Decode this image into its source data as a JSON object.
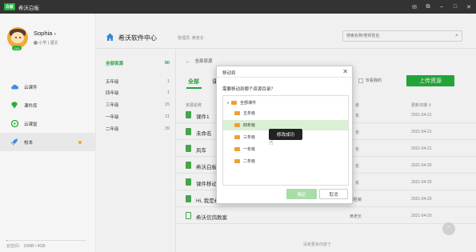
{
  "app": {
    "logo_text": "白板",
    "title": "希沃白板",
    "window_controls": [
      "mail-icon",
      "share-icon",
      "minimize-icon",
      "maximize-icon",
      "close-icon"
    ]
  },
  "user": {
    "name": "Sophia",
    "name_arrow": "▾",
    "meta": "小学 | 语文",
    "level": "LV1"
  },
  "sidebar": {
    "items": [
      {
        "label": "云课件",
        "icon": "cloud-icon"
      },
      {
        "label": "课件库",
        "icon": "diamond-icon"
      },
      {
        "label": "云课堂",
        "icon": "play-circle-icon"
      },
      {
        "label": "校本",
        "icon": "rocket-icon"
      }
    ],
    "storage": "云空间：  16MB / 4GB",
    "storage_fraction": 0.004
  },
  "header": {
    "org_name": "希沃软件中心",
    "admin": "管理员: 黄老长",
    "search_placeholder": "搜索名称/老师姓名",
    "search_icon": "search-icon"
  },
  "categories": {
    "head": {
      "label": "全部资源",
      "count": "90"
    },
    "items": [
      {
        "label": "五年级",
        "count": "1"
      },
      {
        "label": "四年级",
        "count": "1"
      },
      {
        "label": "三年级",
        "count": "15"
      },
      {
        "label": "一年级",
        "count": "11"
      },
      {
        "label": "二年级",
        "count": "39"
      }
    ]
  },
  "main": {
    "back_arrow": "←",
    "crumb": "全部资源",
    "tab_all": "全部",
    "tab_2": "课",
    "mine_only": "仅看我的",
    "upload": "上传资源",
    "col_name": "资源名称",
    "col_owner": "者",
    "col_date": "更新日期 ⇕",
    "rows": [
      {
        "name": "课件1",
        "owner": "长",
        "date": "2021-04-21"
      },
      {
        "name": "未命名",
        "owner": "长",
        "date": "2021-04-21"
      },
      {
        "name": "风车",
        "owner": "长",
        "date": "2021-04-21"
      },
      {
        "name": "希沃白板",
        "owner": "长",
        "date": "2021-04-20"
      },
      {
        "name": "课件移动",
        "owner": "长",
        "date": "2021-04-20"
      },
      {
        "name": "Hi, 我是希沃信鸽",
        "owner": "郑胜菊",
        "date": "2021-04-20"
      },
      {
        "name": "希沃信鸽教案",
        "owner": "黄老长",
        "date": "2021-04-20"
      }
    ],
    "no_more": "没有更多内容了",
    "scroll_top": "⌃"
  },
  "modal": {
    "title": "移动到",
    "close": "✕",
    "question": "需要移动到哪个资源目录？",
    "root": "全部课件",
    "folders": [
      "五年级",
      "四年级",
      "三年级",
      "一年级",
      "二年级"
    ],
    "selected_folder": "四年级",
    "ok": "确定",
    "cancel": "取消"
  },
  "toast": "修改成功",
  "colors": {
    "accent": "#27ae3c",
    "titlebar": "#333333",
    "folder": "#f0a030"
  }
}
